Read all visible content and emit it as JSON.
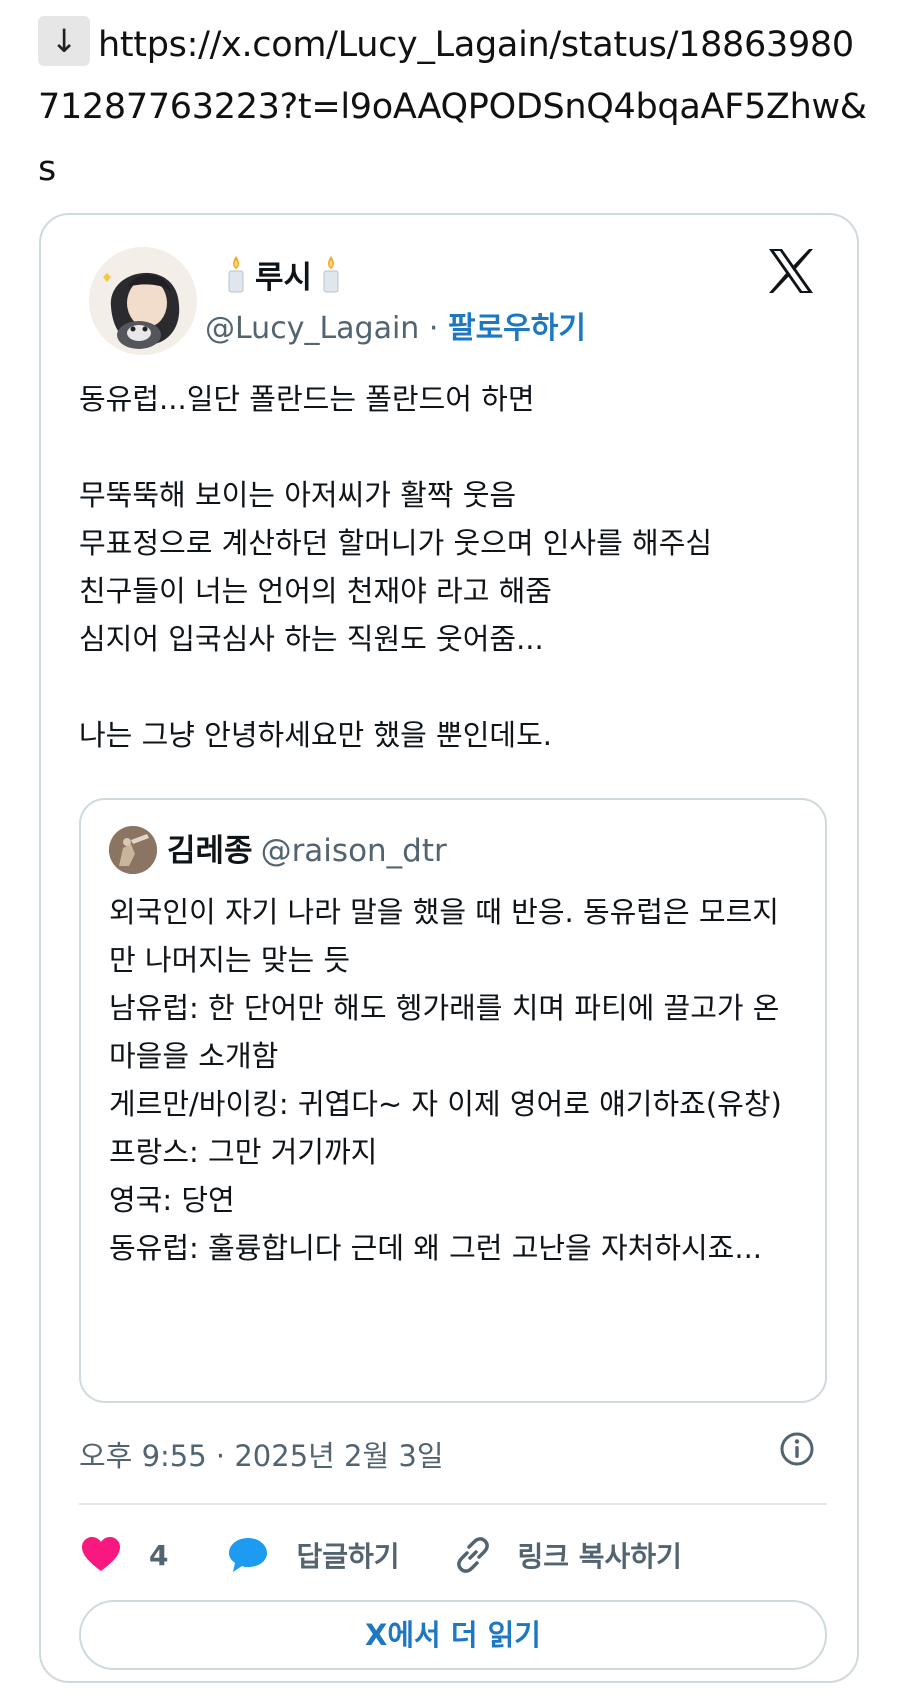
{
  "share": {
    "arrow": "↓",
    "url": "https://x.com/Lucy_Lagain/status/1886398071287763223?t=l9oAAQPODSnQ4bqaAF5Zhw&s"
  },
  "tweet": {
    "author_name": "루시",
    "author_handle": "@Lucy_Lagain",
    "separator": "·",
    "follow_label": "팔로우하기",
    "text": "동유럽...일단 폴란드는 폴란드어 하면\n\n무뚝뚝해 보이는 아저씨가 활짝 웃음\n무표정으로 계산하던 할머니가 웃으며 인사를 해주심\n친구들이 너는 언어의 천재야 라고 해줌\n심지어 입국심사 하는 직원도 웃어줌...\n\n나는 그냥 안녕하세요만 했을 뿐인데도.",
    "timestamp": "오후 9:55 · 2025년 2월 3일",
    "like_count": "4",
    "reply_label": "답글하기",
    "copy_link_label": "링크 복사하기",
    "read_more_label": "X에서 더 읽기"
  },
  "quote": {
    "author_name": "김레종",
    "author_handle": "@raison_dtr",
    "text": "외국인이 자기 나라 말을 했을 때 반응. 동유럽은 모르지만 나머지는 맞는 듯\n남유럽: 한 단어만 해도 헹가래를 치며 파티에 끌고가 온 마을을 소개함\n게르만/바이킹: 귀엽다~ 자 이제 영어로 얘기하죠(유창)\n프랑스: 그만 거기까지\n영국: 당연\n동유럽: 훌륭합니다 근데 왜 그런 고난을 자처하시죠..."
  },
  "icons": {
    "like": "heart-icon",
    "reply": "speech-bubble-icon",
    "copy": "link-icon",
    "info": "info-icon",
    "brand": "x-logo-icon",
    "name_decoration": "candle-icon"
  },
  "colors": {
    "like": "#f91880",
    "reply": "#1d9bf0",
    "link": "#1d78c1",
    "secondary_text": "#536471",
    "border": "#cfd9de"
  }
}
